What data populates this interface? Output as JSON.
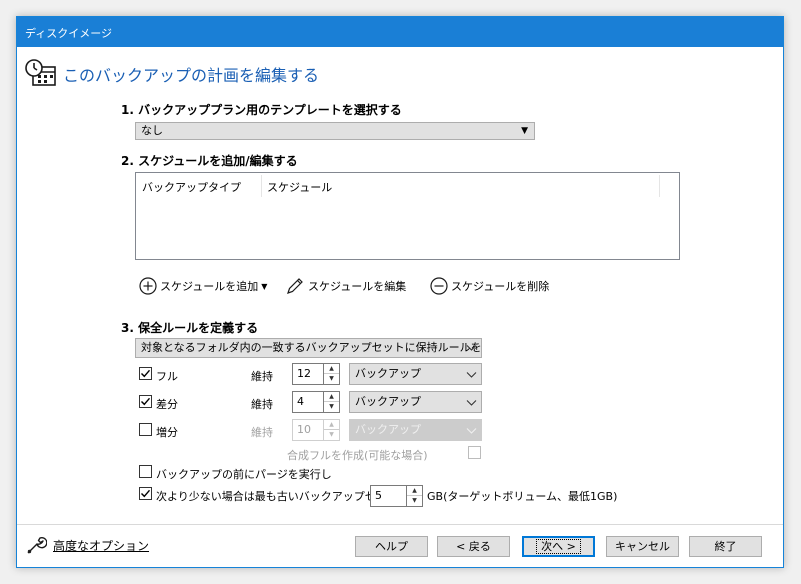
{
  "window": {
    "title": "ディスクイメージ"
  },
  "header": {
    "title": "このバックアップの計画を編集する",
    "icon": "schedule-calendar-icon"
  },
  "section1": {
    "heading": "1. バックアッププラン用のテンプレートを選択する",
    "template_value": "なし"
  },
  "section2": {
    "heading": "2. スケジュールを追加/編集する",
    "columns": [
      "バックアップタイプ",
      "スケジュール"
    ],
    "actions": {
      "add": "スケジュールを追加",
      "edit": "スケジュールを編集",
      "delete": "スケジュールを削除"
    }
  },
  "section3": {
    "heading": "3. 保全ルールを定義する",
    "rule_value": "対象となるフォルダ内の一致するバックアップセットに保持ルールを適用",
    "rows": [
      {
        "label": "フル",
        "checked": true,
        "keep_label": "維持",
        "count": "12",
        "unit": "バックアップ",
        "enabled": true
      },
      {
        "label": "差分",
        "checked": true,
        "keep_label": "維持",
        "count": "4",
        "unit": "バックアップ",
        "enabled": true
      },
      {
        "label": "増分",
        "checked": false,
        "keep_label": "維持",
        "count": "10",
        "unit": "バックアップ",
        "enabled": false
      }
    ],
    "synthetic_full": "合成フルを作成(可能な場合)",
    "purge_before": {
      "label": "バックアップの前にパージを実行し",
      "checked": false
    },
    "min_space": {
      "label": "次より少ない場合は最も古いバックアップセット",
      "checked": true,
      "value": "5",
      "suffix": "GB(ターゲットボリューム、最低1GB)"
    }
  },
  "footer": {
    "advanced": "高度なオプション",
    "buttons": {
      "help": "ヘルプ",
      "back": "< 戻る",
      "next": "次へ >",
      "cancel": "キャンセル",
      "finish": "終了"
    }
  },
  "colors": {
    "accent": "#1a7fd6",
    "header_text": "#1a5fb4"
  }
}
